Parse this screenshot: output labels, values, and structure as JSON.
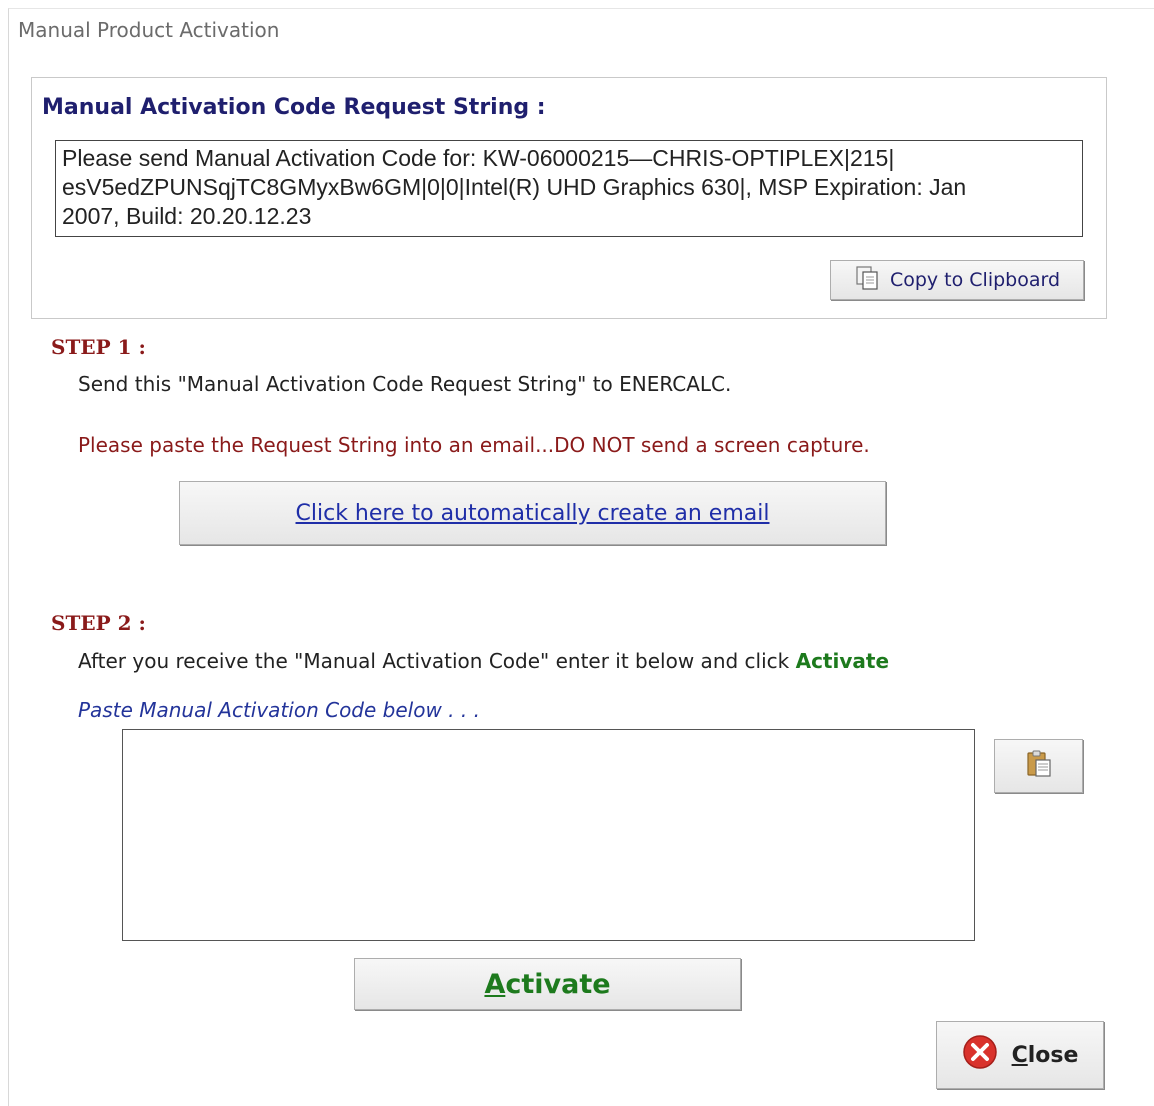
{
  "window": {
    "title": "Manual Product Activation"
  },
  "request": {
    "group_title": "Manual Activation Code Request String :",
    "line1": "Please send Manual Activation Code for: KW-06000215—CHRIS-OPTIPLEX|215|",
    "line2": "esV5edZPUNSqjTC8GMyxBw6GM|0|0|Intel(R) UHD Graphics 630|,  MSP Expiration: Jan",
    "line3": "2007,  Build: 20.20.12.23",
    "copy_label": "Copy to Clipboard"
  },
  "step1": {
    "title": "STEP 1 :",
    "instruction": "Send this \"Manual Activation Code Request String\"  to ENERCALC.",
    "warning": "Please paste the Request String into an email...DO NOT send a screen capture.",
    "email_button": "Click here to automatically create an email"
  },
  "step2": {
    "title": "STEP 2 :",
    "instruction_prefix": "After you receive the \"Manual Activation Code\" enter it below and click ",
    "instruction_action": "Activate",
    "hint": "Paste Manual Activation Code below . . .",
    "code_value": ""
  },
  "activate": {
    "accel": "A",
    "rest": "ctivate"
  },
  "close": {
    "accel": "C",
    "rest": "lose"
  },
  "colors": {
    "step_title": "#8a1a1a",
    "activate_green": "#1d7a1d",
    "link_blue": "#1f2ea8",
    "group_title_navy": "#1f1f6e"
  },
  "icons": {
    "copy": "copy-icon",
    "paste": "paste-icon",
    "close": "close-circle-icon"
  }
}
